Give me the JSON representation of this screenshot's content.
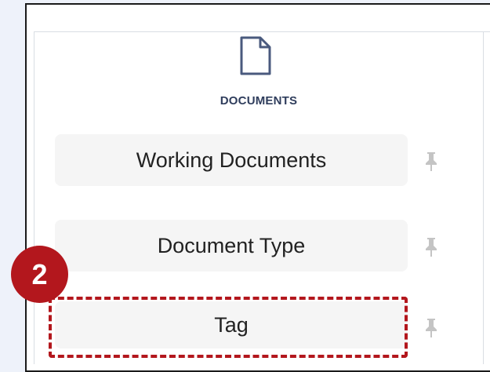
{
  "sidebar": {
    "section_label": "DOCUMENTS",
    "section_icon": "document-icon",
    "items": [
      {
        "label": "Working Documents",
        "pin_icon": "pin-icon"
      },
      {
        "label": "Document Type",
        "pin_icon": "pin-icon"
      },
      {
        "label": "Tag",
        "pin_icon": "pin-icon",
        "highlighted": true
      }
    ]
  },
  "annotation": {
    "step_number": "2",
    "color": "#b3171d"
  },
  "colors": {
    "background": "#eef2fa",
    "item_background": "#f5f5f5",
    "icon_stroke": "#4a5a7e",
    "pin": "#c4c4c4"
  }
}
